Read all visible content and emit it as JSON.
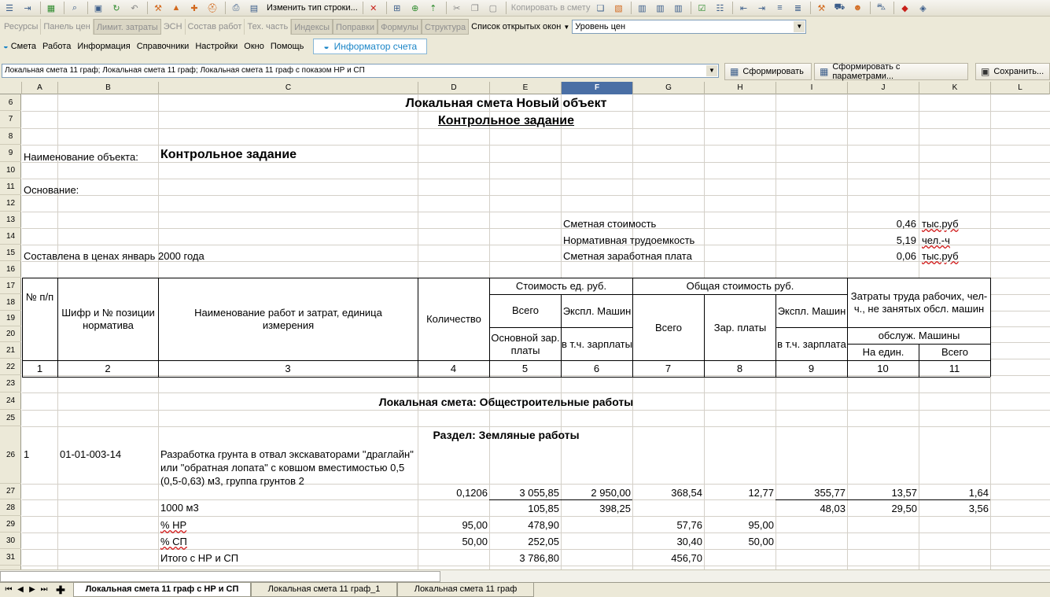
{
  "toolbar": {
    "change_row_type": "Изменить тип строки...",
    "copy_to_estimate": "Копировать в смету"
  },
  "tabs_panel": {
    "items": [
      "Ресурсы",
      "Панель цен",
      "Лимит. затраты",
      "ЭСН",
      "Состав работ",
      "Тех. часть",
      "Индексы",
      "Поправки",
      "Формулы",
      "Структура"
    ],
    "open_windows_label": "Список открытых окон",
    "price_level_value": "Уровень цен"
  },
  "menubar": {
    "items": [
      "Смета",
      "Работа",
      "Информация",
      "Справочники",
      "Настройки",
      "Окно",
      "Помощь"
    ],
    "informer": "Информатор счета"
  },
  "report": {
    "selected": "Локальная смета 11 граф; Локальная смета 11 граф; Локальная смета 11 граф с показом НР и СП",
    "build_button": "Сформировать",
    "build_params_button": "Сформировать с параметрами...",
    "save_button": "Сохранить..."
  },
  "sheet": {
    "columns": [
      "A",
      "B",
      "C",
      "D",
      "E",
      "F",
      "G",
      "H",
      "I",
      "J",
      "K",
      "L"
    ],
    "selected_column": "F",
    "rows": [
      "6",
      "7",
      "8",
      "9",
      "10",
      "11",
      "12",
      "13",
      "14",
      "15",
      "16",
      "17",
      "18",
      "19",
      "20",
      "21",
      "22",
      "23",
      "24",
      "25",
      "26",
      "27",
      "28",
      "29",
      "30",
      "31"
    ],
    "title": "Локальная смета Новый объект",
    "subtitle": "Контрольное задание",
    "object_label": "Наименование объекта:",
    "object_value": "Контрольное задание",
    "basis_label": "Основание:",
    "prices_note": "Составлена в ценах январь 2000 года",
    "summary": [
      {
        "label": "Сметная стоимость",
        "value": "0,46",
        "unit": "тыс.руб"
      },
      {
        "label": "Нормативная трудоемкость",
        "value": "5,19",
        "unit": "чел.-ч"
      },
      {
        "label": "Сметная заработная плата",
        "value": "0,06",
        "unit": "тыс.руб"
      }
    ],
    "header": {
      "no": "№ п/п",
      "code": "Шифр и № позиции норматива",
      "name": "Наименование работ и затрат, единица измерения",
      "qty": "Количество",
      "unit_cost": "Стоимость ед. руб.",
      "total_cost": "Общая стоимость руб.",
      "labor": "Затраты труда рабочих, чел-ч., не занятых обсл. машин",
      "all": "Всего",
      "machines": "Экспл. Машин",
      "base_wage": "Основной зар. платы",
      "incl_wage": "в т.ч. зарплаты",
      "all2": "Всего",
      "wage": "Зар. платы",
      "machines2": "Экспл. Машин",
      "incl_wage2": "в т.ч. зарплата",
      "machine_service": "обслуж. Машины",
      "per_unit": "На един.",
      "all3": "Всего"
    },
    "col_numbers": [
      "1",
      "2",
      "3",
      "4",
      "5",
      "6",
      "7",
      "8",
      "9",
      "10",
      "11"
    ],
    "section1": "Локальная смета: Общестроительные работы",
    "section2": "Раздел: Земляные работы",
    "item": {
      "no": "1",
      "code": "01-01-003-14",
      "name": "Разработка грунта в отвал экскаваторами \"драглайн\" или \"обратная лопата\" с ковшом вместимостью 0,5 (0,5-0,63) м3, группа грунтов 2",
      "qty": "0,1206",
      "e": "3 055,85",
      "f": "2 950,00",
      "g": "368,54",
      "h": "12,77",
      "i": "355,77",
      "j": "13,57",
      "k": "1,64"
    },
    "row27": {
      "unit": "1000 м3",
      "e": "105,85",
      "f": "398,25",
      "i": "48,03",
      "j": "29,50",
      "k": "3,56"
    },
    "row28": {
      "label": "% НР",
      "d": "95,00",
      "e": "478,90",
      "g": "57,76",
      "h": "95,00"
    },
    "row29": {
      "label": "% СП",
      "d": "50,00",
      "e": "252,05",
      "g": "30,40",
      "h": "50,00"
    },
    "row30": {
      "label": "Итого с НР и СП",
      "e": "3 786,80",
      "g": "456,70"
    }
  },
  "sheet_tabs": [
    "Локальная смета 11 граф с НР и СП",
    "Локальная смета 11 граф_1",
    "Локальная смета 11 граф"
  ]
}
